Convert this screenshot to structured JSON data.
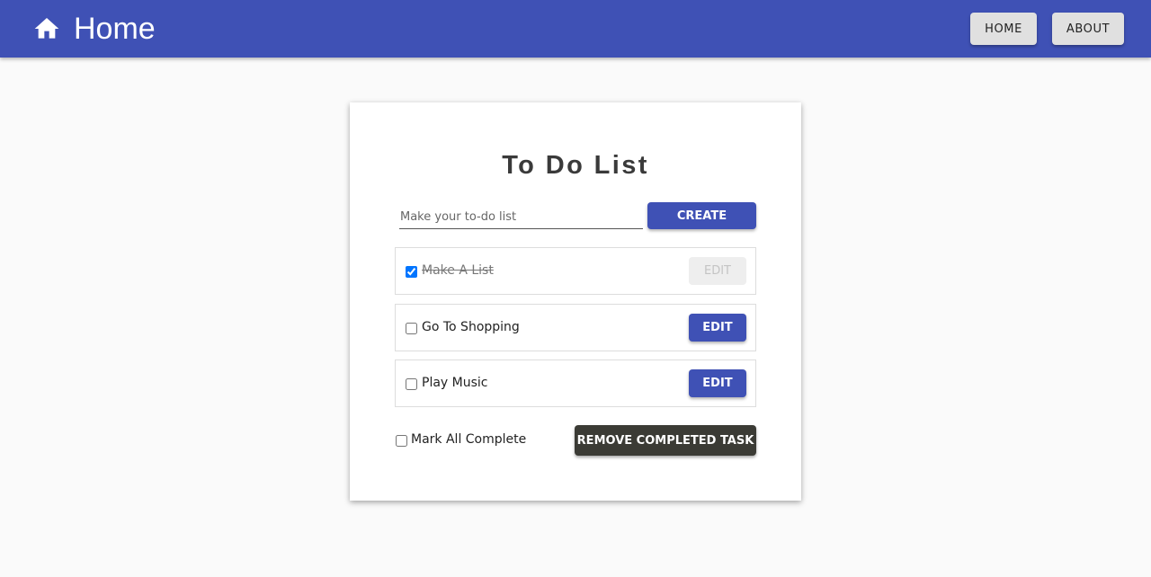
{
  "appbar": {
    "icon": "home-icon",
    "title": "Home",
    "nav": {
      "home_label": "HOME",
      "about_label": "ABOUT"
    },
    "colors": {
      "background": "#3f51b5"
    }
  },
  "todo": {
    "title": "To Do List",
    "input": {
      "placeholder": "Make your to-do list",
      "value": ""
    },
    "create_label": "CREATE",
    "tasks": [
      {
        "label": "Make A List",
        "checked": true,
        "edit_label": "EDIT",
        "edit_disabled": true
      },
      {
        "label": "Go To Shopping",
        "checked": false,
        "edit_label": "EDIT",
        "edit_disabled": false
      },
      {
        "label": "Play Music",
        "checked": false,
        "edit_label": "EDIT",
        "edit_disabled": false
      }
    ],
    "mark_all_label": "Mark All Complete",
    "mark_all_checked": false,
    "remove_label": "REMOVE COMPLETED TASK",
    "colors": {
      "primary": "#3f51b5",
      "remove_button": "#3b3b35"
    }
  }
}
